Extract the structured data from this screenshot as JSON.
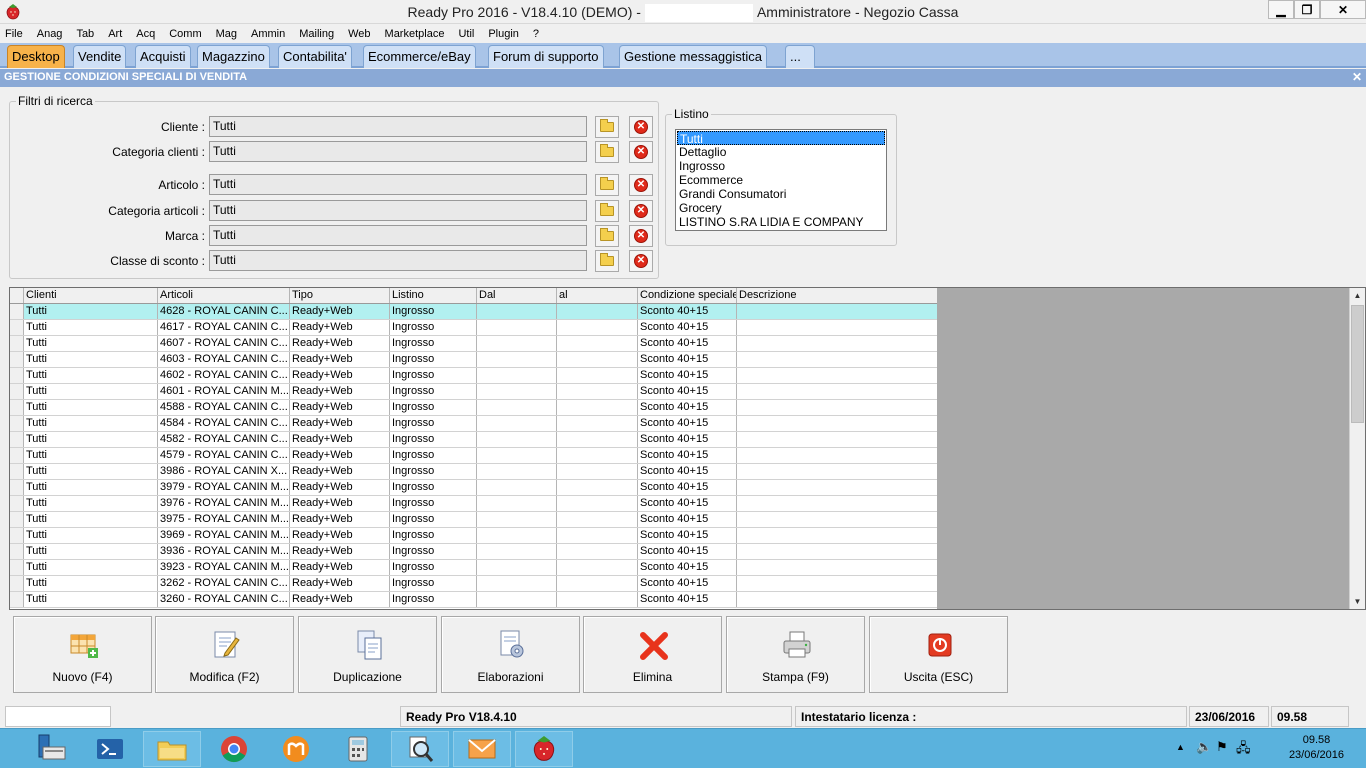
{
  "window": {
    "title_left": "Ready Pro 2016 - V18.4.10 (DEMO) -",
    "title_right": "Amministratore - Negozio Cassa",
    "min_label": "▁",
    "max_label": "❐",
    "close_label": "✕"
  },
  "menu": [
    "File",
    "Anag",
    "Tab",
    "Art",
    "Acq",
    "Comm",
    "Mag",
    "Ammin",
    "Mailing",
    "Web",
    "Marketplace",
    "Util",
    "Plugin",
    "?"
  ],
  "tabs": [
    "Desktop",
    "Vendite",
    "Acquisti",
    "Magazzino",
    "Contabilita'",
    "Ecommerce/eBay",
    "Forum di supporto",
    "Gestione messaggistica",
    "..."
  ],
  "section": {
    "title": "GESTIONE CONDIZIONI SPECIALI DI VENDITA",
    "close": "✕"
  },
  "filters": {
    "legend": "Filtri di ricerca",
    "rows": [
      {
        "label": "Cliente :",
        "value": "Tutti"
      },
      {
        "label": "Categoria clienti :",
        "value": "Tutti"
      },
      {
        "label": "Articolo :",
        "value": "Tutti"
      },
      {
        "label": "Categoria articoli :",
        "value": "Tutti"
      },
      {
        "label": "Marca :",
        "value": "Tutti"
      },
      {
        "label": "Classe di sconto :",
        "value": "Tutti"
      }
    ]
  },
  "listino": {
    "legend": "Listino",
    "items": [
      "Tutti",
      "Dettaglio",
      "Ingrosso",
      "Ecommerce",
      "Grandi Consumatori",
      "Grocery",
      "LISTINO S.RA LIDIA E COMPANY"
    ],
    "selected": "Tutti"
  },
  "grid": {
    "columns": [
      "Clienti",
      "Articoli",
      "Tipo",
      "Listino",
      "Dal",
      "al",
      "Condizione speciale",
      "Descrizione"
    ],
    "rows": [
      [
        "Tutti",
        "4628 - ROYAL CANIN C...",
        "Ready+Web",
        "Ingrosso",
        "",
        "",
        "Sconto 40+15",
        ""
      ],
      [
        "Tutti",
        "4617 - ROYAL CANIN C...",
        "Ready+Web",
        "Ingrosso",
        "",
        "",
        "Sconto 40+15",
        ""
      ],
      [
        "Tutti",
        "4607 - ROYAL CANIN C...",
        "Ready+Web",
        "Ingrosso",
        "",
        "",
        "Sconto 40+15",
        ""
      ],
      [
        "Tutti",
        "4603 - ROYAL CANIN C...",
        "Ready+Web",
        "Ingrosso",
        "",
        "",
        "Sconto 40+15",
        ""
      ],
      [
        "Tutti",
        "4602 - ROYAL CANIN C...",
        "Ready+Web",
        "Ingrosso",
        "",
        "",
        "Sconto 40+15",
        ""
      ],
      [
        "Tutti",
        "4601 - ROYAL CANIN M...",
        "Ready+Web",
        "Ingrosso",
        "",
        "",
        "Sconto 40+15",
        ""
      ],
      [
        "Tutti",
        "4588 - ROYAL CANIN C...",
        "Ready+Web",
        "Ingrosso",
        "",
        "",
        "Sconto 40+15",
        ""
      ],
      [
        "Tutti",
        "4584 - ROYAL CANIN C...",
        "Ready+Web",
        "Ingrosso",
        "",
        "",
        "Sconto 40+15",
        ""
      ],
      [
        "Tutti",
        "4582 - ROYAL CANIN C...",
        "Ready+Web",
        "Ingrosso",
        "",
        "",
        "Sconto 40+15",
        ""
      ],
      [
        "Tutti",
        "4579 - ROYAL CANIN C...",
        "Ready+Web",
        "Ingrosso",
        "",
        "",
        "Sconto 40+15",
        ""
      ],
      [
        "Tutti",
        "3986 - ROYAL CANIN X...",
        "Ready+Web",
        "Ingrosso",
        "",
        "",
        "Sconto 40+15",
        ""
      ],
      [
        "Tutti",
        "3979 - ROYAL CANIN M...",
        "Ready+Web",
        "Ingrosso",
        "",
        "",
        "Sconto 40+15",
        ""
      ],
      [
        "Tutti",
        "3976 - ROYAL CANIN M...",
        "Ready+Web",
        "Ingrosso",
        "",
        "",
        "Sconto 40+15",
        ""
      ],
      [
        "Tutti",
        "3975 - ROYAL CANIN M...",
        "Ready+Web",
        "Ingrosso",
        "",
        "",
        "Sconto 40+15",
        ""
      ],
      [
        "Tutti",
        "3969 - ROYAL CANIN M...",
        "Ready+Web",
        "Ingrosso",
        "",
        "",
        "Sconto 40+15",
        ""
      ],
      [
        "Tutti",
        "3936 - ROYAL CANIN M...",
        "Ready+Web",
        "Ingrosso",
        "",
        "",
        "Sconto 40+15",
        ""
      ],
      [
        "Tutti",
        "3923 - ROYAL CANIN M...",
        "Ready+Web",
        "Ingrosso",
        "",
        "",
        "Sconto 40+15",
        ""
      ],
      [
        "Tutti",
        "3262 - ROYAL CANIN C...",
        "Ready+Web",
        "Ingrosso",
        "",
        "",
        "Sconto 40+15",
        ""
      ],
      [
        "Tutti",
        "3260 - ROYAL CANIN C...",
        "Ready+Web",
        "Ingrosso",
        "",
        "",
        "Sconto 40+15",
        ""
      ]
    ],
    "selected_row": 0
  },
  "actions": [
    {
      "label": "Nuovo (F4)",
      "icon": "new-grid-icon"
    },
    {
      "label": "Modifica (F2)",
      "icon": "edit-document-icon"
    },
    {
      "label": "Duplicazione",
      "icon": "duplicate-icon"
    },
    {
      "label": "Elaborazioni",
      "icon": "process-gear-icon"
    },
    {
      "label": "Elimina",
      "icon": "delete-x-icon"
    },
    {
      "label": "Stampa (F9)",
      "icon": "printer-icon"
    },
    {
      "label": "Uscita (ESC)",
      "icon": "exit-power-icon"
    }
  ],
  "status": {
    "version": "Ready Pro V18.4.10",
    "license": "Intestatario licenza :",
    "date": "23/06/2016",
    "time": "09.58"
  },
  "taskbar": {
    "clock_time": "09.58",
    "clock_date": "23/06/2016"
  },
  "colors": {
    "tab_active": "#f7b24a",
    "tab_bar": "#a9c4e8",
    "section_header": "#8aa9d6",
    "row_selected": "#b2f0f0",
    "taskbar": "#5ab2dd"
  }
}
